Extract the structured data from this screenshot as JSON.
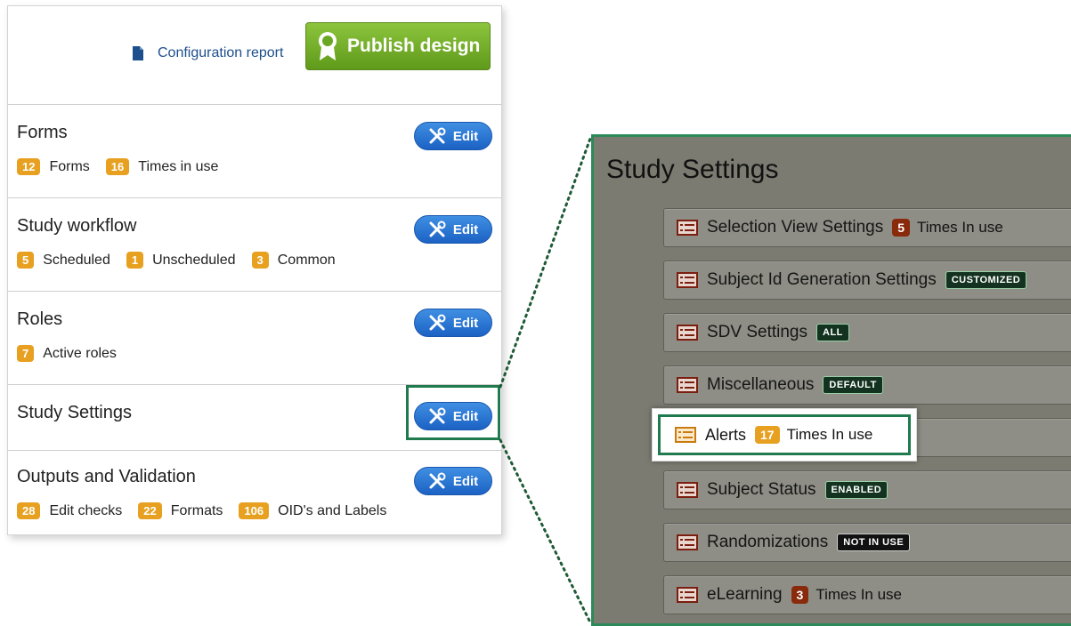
{
  "header": {
    "config_report_label": "Configuration report",
    "publish_label": "Publish design"
  },
  "sections": [
    {
      "title": "Forms",
      "edit_label": "Edit",
      "stats": [
        {
          "count": "12",
          "label": "Forms"
        },
        {
          "count": "16",
          "label": "Times in use"
        }
      ]
    },
    {
      "title": "Study workflow",
      "edit_label": "Edit",
      "stats": [
        {
          "count": "5",
          "label": "Scheduled"
        },
        {
          "count": "1",
          "label": "Unscheduled"
        },
        {
          "count": "3",
          "label": "Common"
        }
      ]
    },
    {
      "title": "Roles",
      "edit_label": "Edit",
      "stats": [
        {
          "count": "7",
          "label": "Active roles"
        }
      ]
    },
    {
      "title": "Study Settings",
      "edit_label": "Edit",
      "stats": []
    },
    {
      "title": "Outputs and Validation",
      "edit_label": "Edit",
      "stats": [
        {
          "count": "28",
          "label": "Edit checks"
        },
        {
          "count": "22",
          "label": "Formats"
        },
        {
          "count": "106",
          "label": "OID's and Labels"
        }
      ]
    }
  ],
  "study_settings": {
    "title": "Study Settings",
    "items": [
      {
        "label": "Selection View Settings",
        "count": "5",
        "count_style": "dark-red",
        "suffix": "Times In use"
      },
      {
        "label": "Subject Id Generation Settings",
        "tag": "CUSTOMIZED"
      },
      {
        "label": "SDV Settings",
        "tag": "ALL"
      },
      {
        "label": "Miscellaneous",
        "tag": "DEFAULT"
      },
      {
        "label": "Alerts",
        "count": "17",
        "count_style": "orange",
        "suffix": "Times In use"
      },
      {
        "label": "Subject Status",
        "tag": "ENABLED"
      },
      {
        "label": "Randomizations",
        "tag": "NOT IN USE",
        "tag_style": "black"
      },
      {
        "label": "eLearning",
        "count": "3",
        "count_style": "dark-red",
        "suffix": "Times In use"
      }
    ]
  },
  "colors": {
    "publish_green": "#6aa823",
    "edit_blue": "#2a74d6",
    "badge_orange": "#e8a020",
    "highlight_green": "#1f7a4e",
    "zoom_background": "#7b7b71"
  }
}
